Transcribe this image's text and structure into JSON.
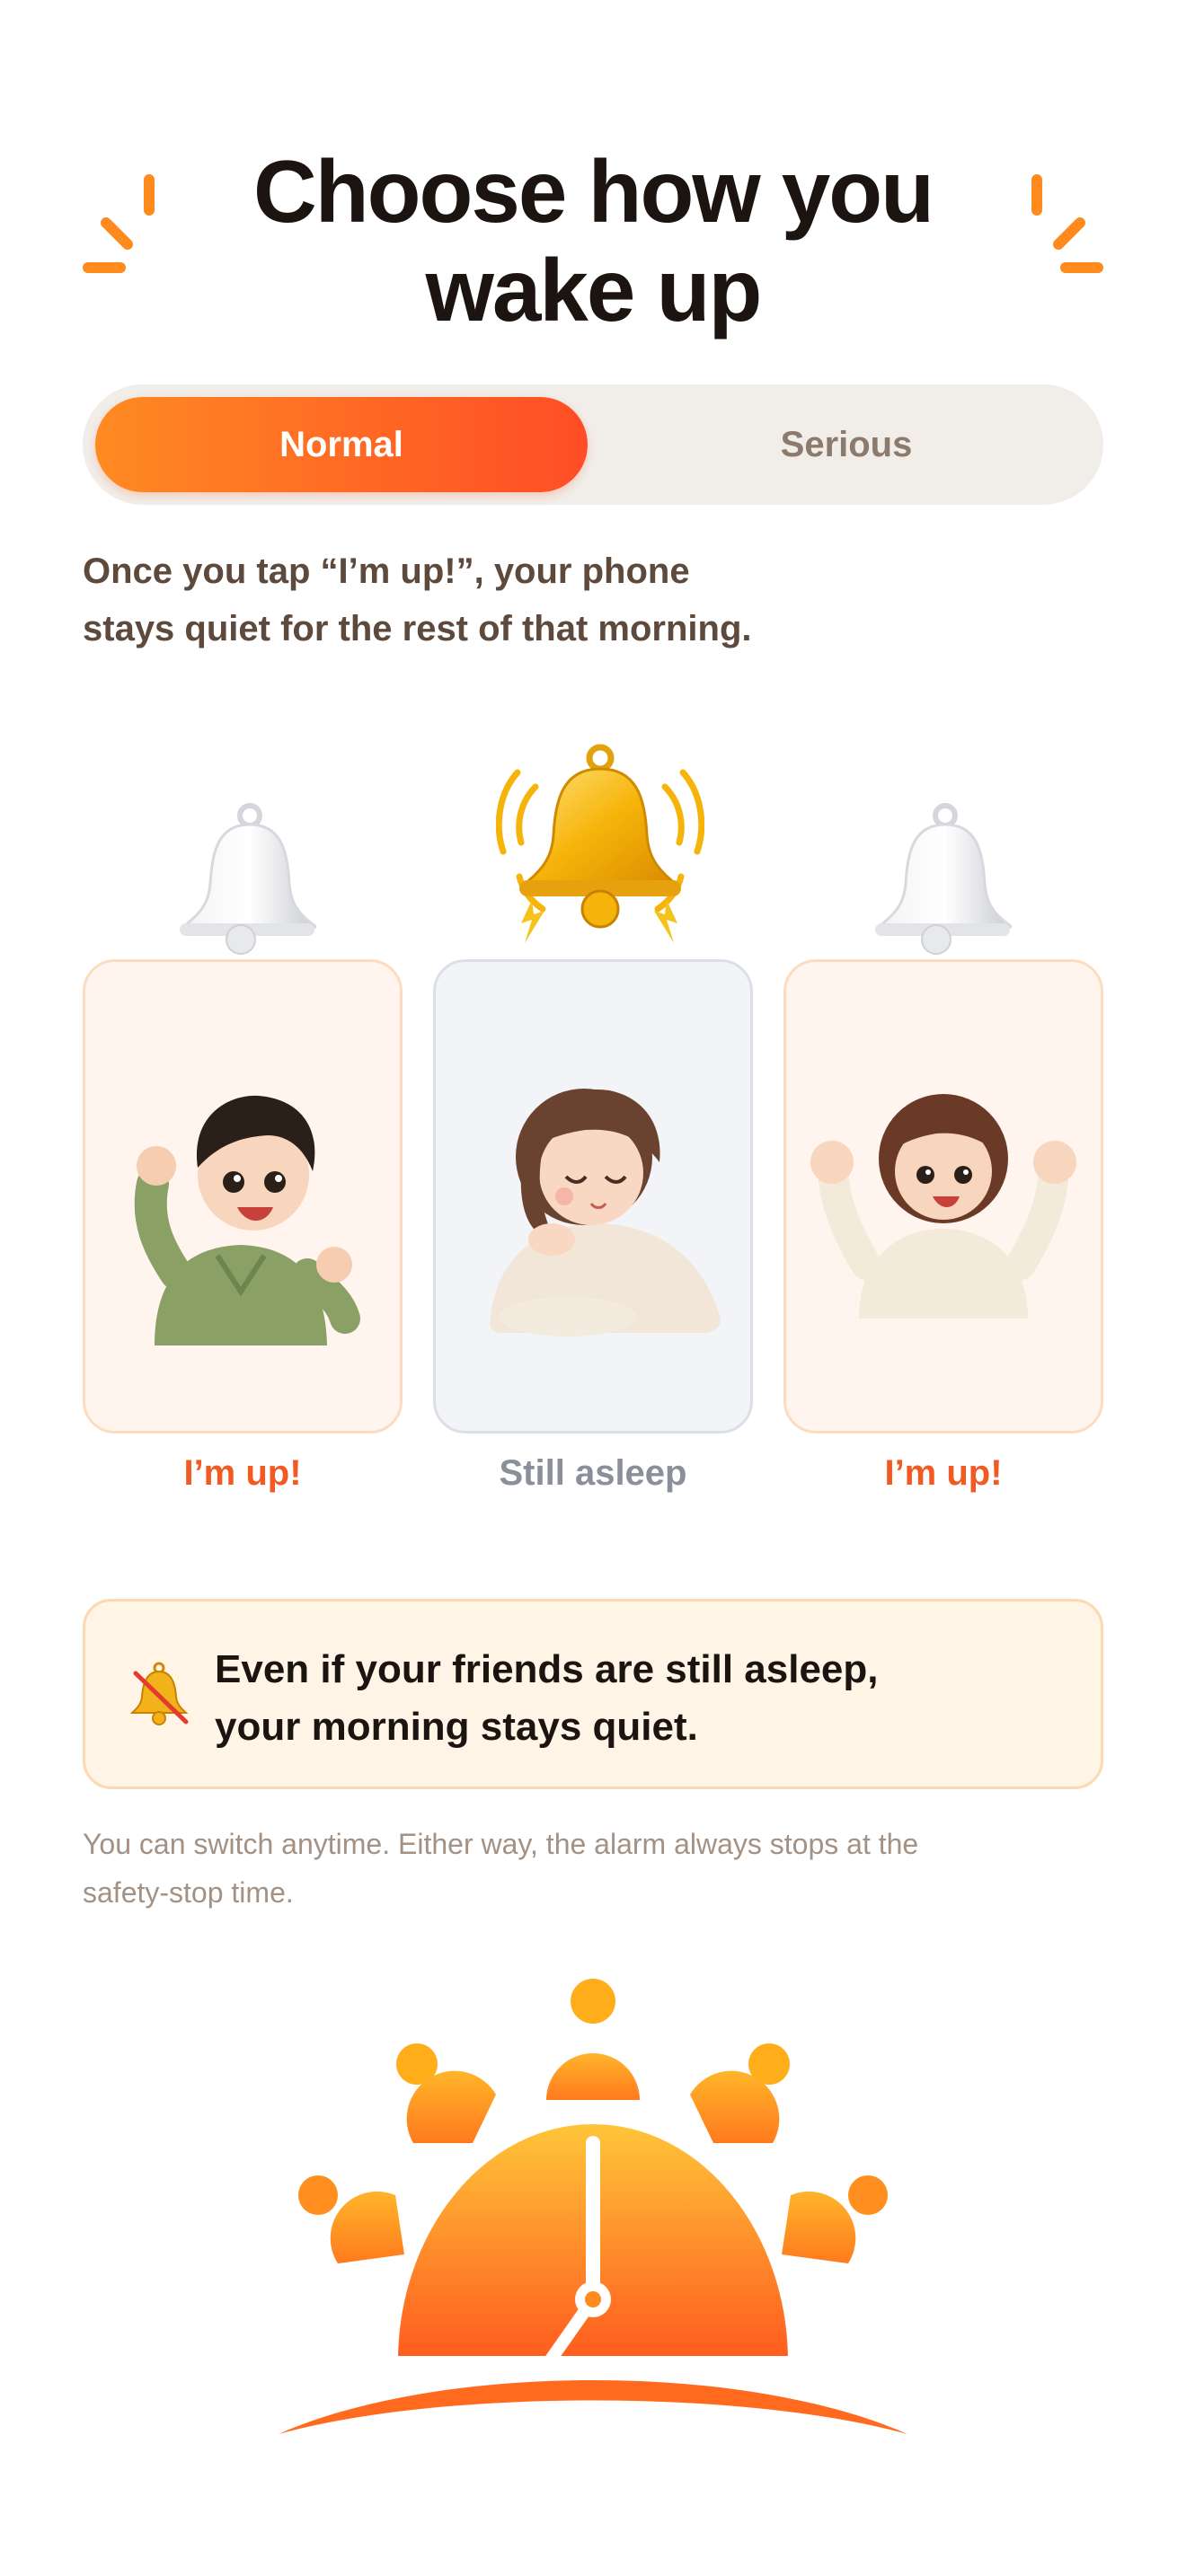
{
  "header": {
    "title_line1": "Choose how you",
    "title_line2": "wake up"
  },
  "mode_toggle": {
    "options": [
      "Normal",
      "Serious"
    ],
    "selected": "Normal"
  },
  "description": {
    "line1": "Once you tap “I’m up!”, your phone",
    "line2": "stays quiet for the rest of that morning."
  },
  "illustration": {
    "cards": [
      {
        "label": "I’m up!",
        "state": "awake",
        "bell": "silent-bell-icon"
      },
      {
        "label": "Still asleep",
        "state": "asleep",
        "bell": "ringing-bell-icon"
      },
      {
        "label": "I’m up!",
        "state": "awake",
        "bell": "silent-bell-icon"
      }
    ]
  },
  "info_box": {
    "icon": "muted-bell-icon",
    "line1": "Even if your friends are still asleep,",
    "line2": "your morning stays quiet."
  },
  "footnote": {
    "line1": "You can switch anytime. Either way, the alarm always stops at the",
    "line2": "safety-stop time."
  },
  "colors": {
    "accent_orange": "#ff6a24",
    "title": "#1c1410",
    "awake_label": "#f15a22",
    "asleep_label": "#8a8f99",
    "segment_bg": "#f1eeea",
    "info_bg": "#fff4e6"
  }
}
